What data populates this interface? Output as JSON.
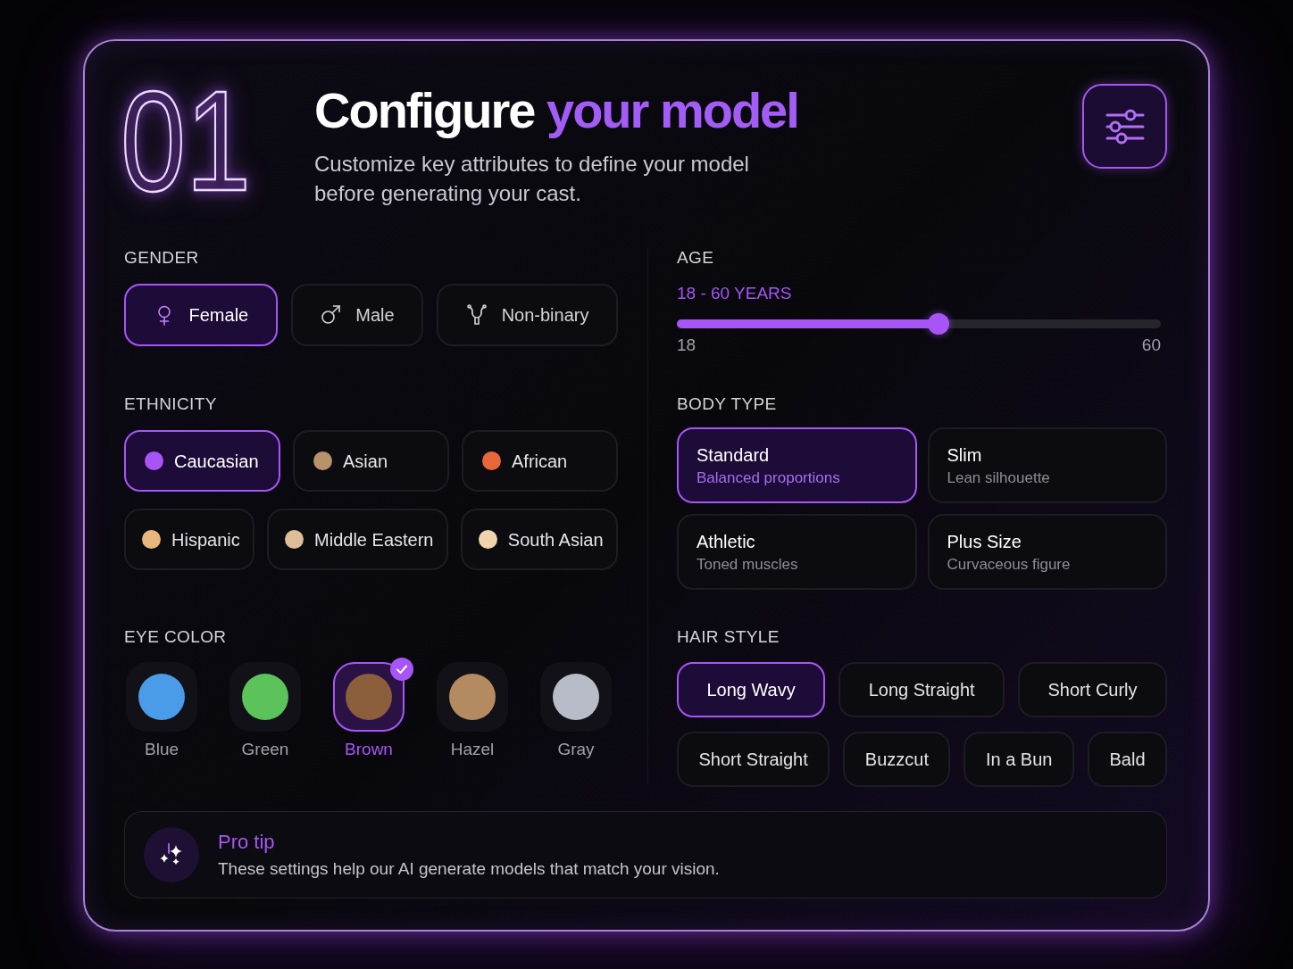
{
  "header": {
    "number": "01",
    "title": [
      {
        "text": "Configure",
        "accent": false
      },
      {
        "text": "your model",
        "accent": true
      }
    ],
    "subtitle": "Customize key attributes to define your model before generating your cast."
  },
  "gender": {
    "label": "GENDER",
    "options": [
      {
        "label": "Female",
        "kind": "female",
        "selected": true
      },
      {
        "label": "Male",
        "kind": "male",
        "selected": false
      },
      {
        "label": "Non-binary",
        "kind": "nonbinary",
        "selected": false
      }
    ]
  },
  "age": {
    "label": "AGE",
    "range": "18 - 60 YEARS",
    "level": 0.54,
    "min_label": "18",
    "max_label": "60"
  },
  "ethnicity": {
    "label": "ETHNICITY",
    "options": [
      {
        "label": "Caucasian",
        "color": "#a855f7",
        "selected": true
      },
      {
        "label": "Asian",
        "color": "#b8926a",
        "selected": false
      },
      {
        "label": "African",
        "color": "#e8683a",
        "selected": false
      },
      {
        "label": "Hispanic",
        "color": "#e8b77e",
        "selected": false
      },
      {
        "label": "Middle Eastern",
        "color": "#dcbf96",
        "selected": false
      },
      {
        "label": "South Asian",
        "color": "#f0d4ac",
        "selected": false
      }
    ]
  },
  "body_type": {
    "label": "BODY TYPE",
    "options": [
      {
        "title": "Standard",
        "description": "Balanced proportions",
        "selected": true
      },
      {
        "title": "Slim",
        "description": "Lean silhouette",
        "selected": false
      },
      {
        "title": "Athletic",
        "description": "Toned muscles",
        "selected": false
      },
      {
        "title": "Plus Size",
        "description": "Curvaceous figure",
        "selected": false
      }
    ]
  },
  "eye_color": {
    "label": "EYE COLOR",
    "options": [
      {
        "label": "Blue",
        "color": "#4a9be8",
        "selected": false
      },
      {
        "label": "Green",
        "color": "#5cc25a",
        "selected": false
      },
      {
        "label": "Brown",
        "color": "#8b5e3c",
        "selected": true
      },
      {
        "label": "Hazel",
        "color": "#b48a60",
        "selected": false
      },
      {
        "label": "Gray",
        "color": "#b8bcc8",
        "selected": false
      }
    ]
  },
  "hair_style": {
    "label": "HAIR STYLE",
    "options": [
      {
        "label": "Long Wavy",
        "selected": true
      },
      {
        "label": "Long Straight",
        "selected": false
      },
      {
        "label": "Short Curly",
        "selected": false
      },
      {
        "label": "Short Straight",
        "selected": false
      },
      {
        "label": "Buzzcut",
        "selected": false
      },
      {
        "label": "In a Bun",
        "selected": false
      },
      {
        "label": "Bald",
        "selected": false
      }
    ]
  },
  "pro_tip": {
    "title": "Pro tip",
    "text": "These settings help our AI generate models that match your vision."
  }
}
